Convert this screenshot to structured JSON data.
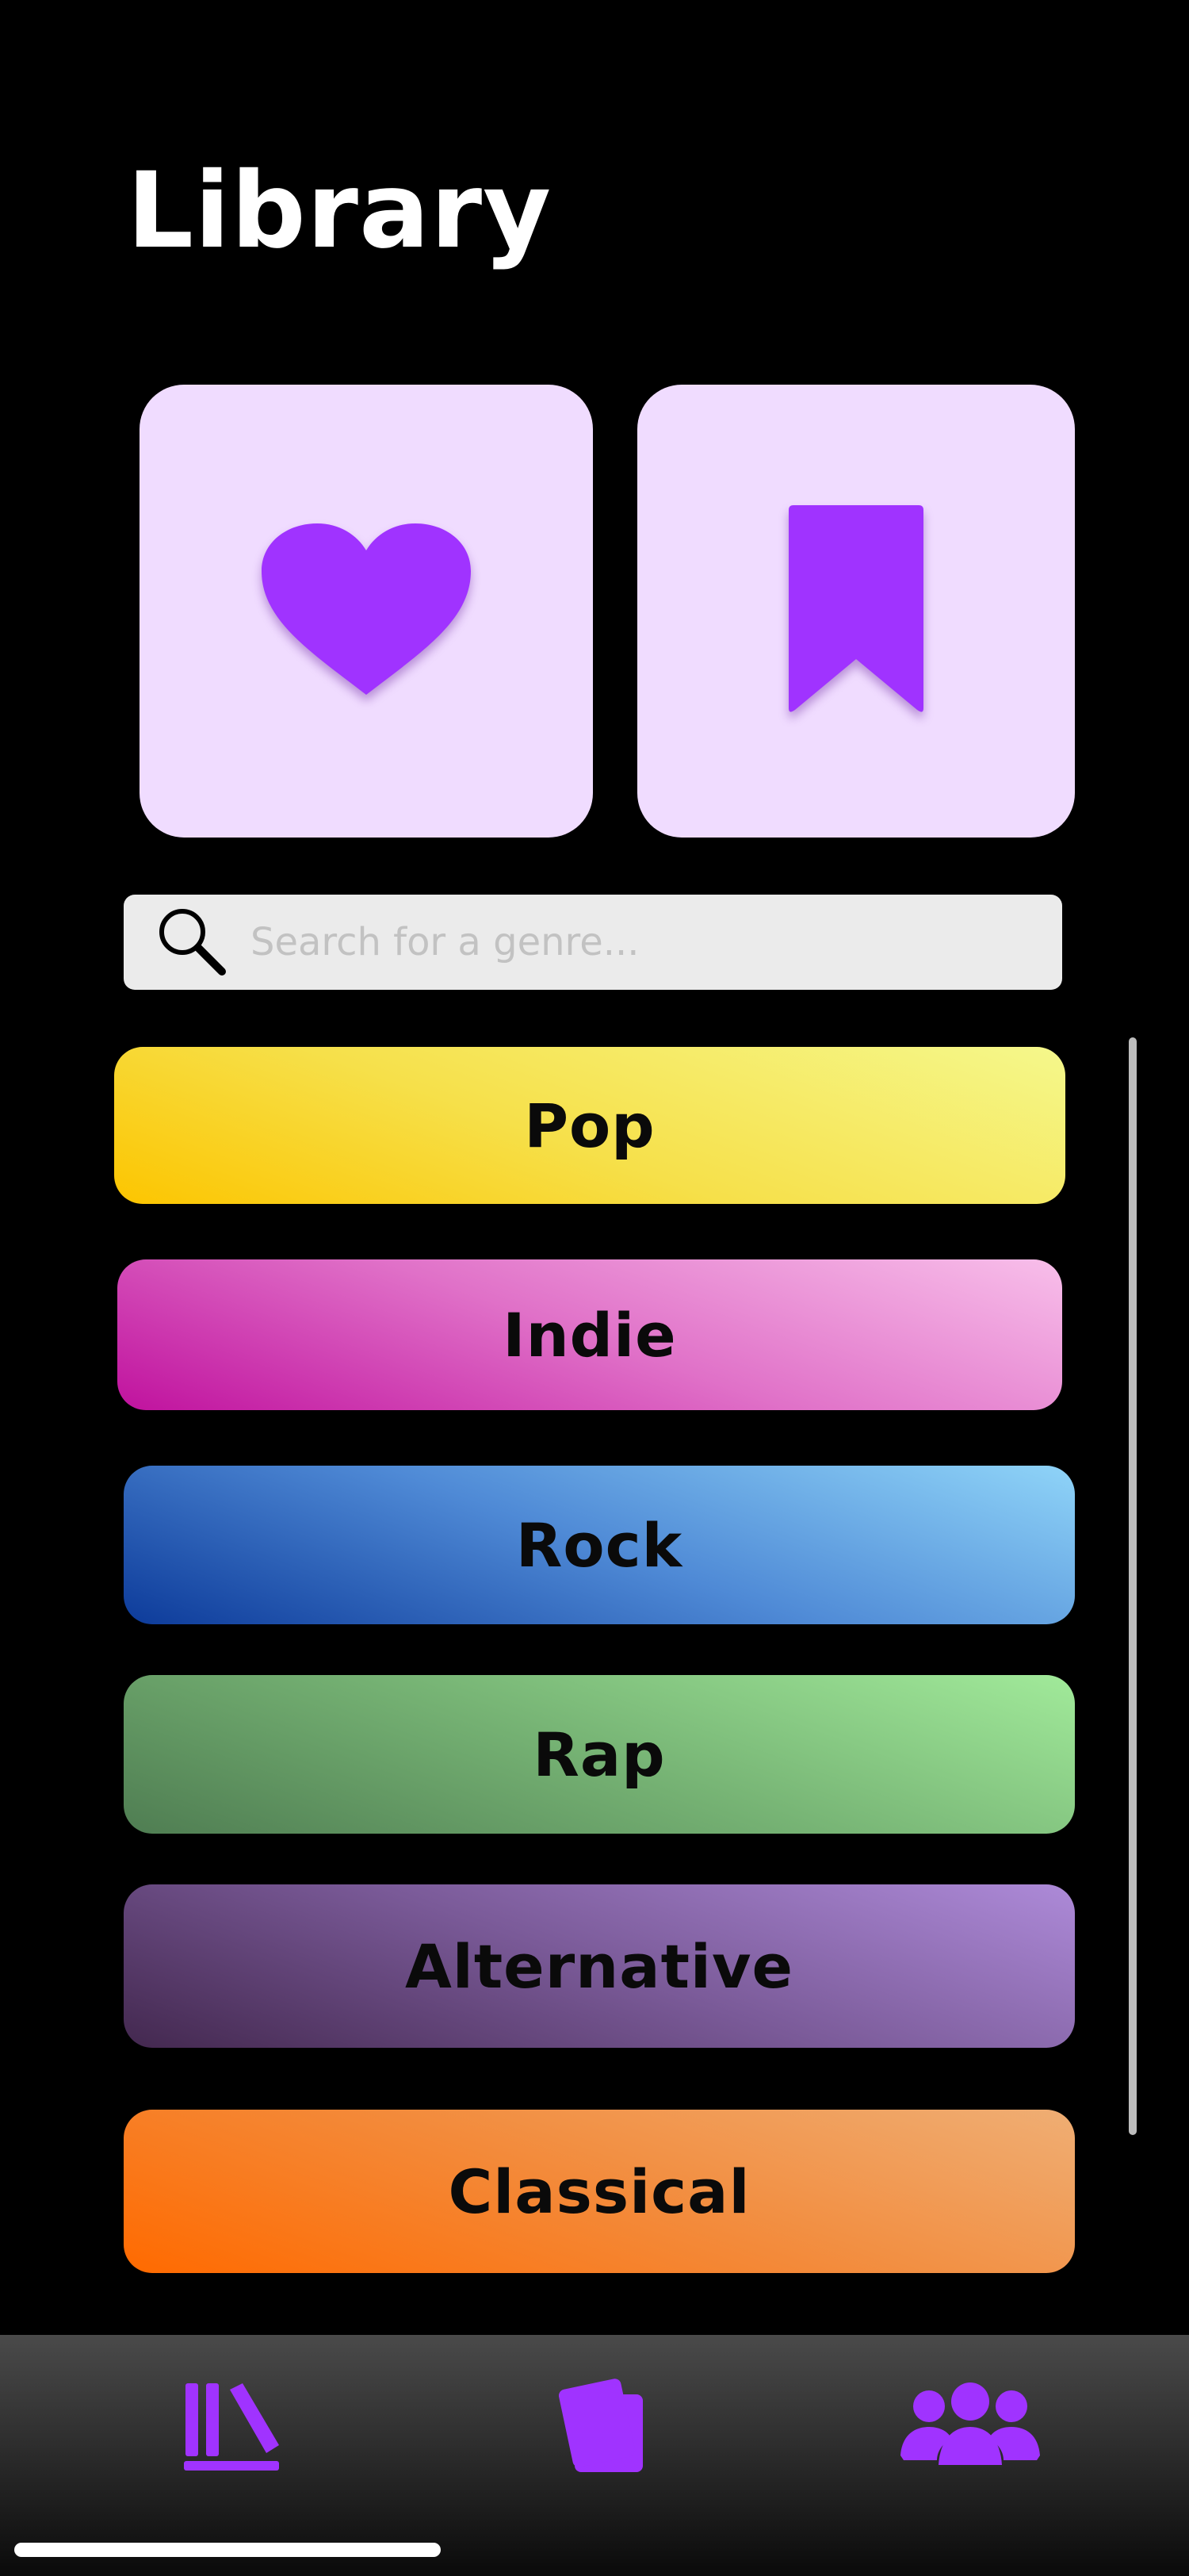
{
  "header": {
    "title": "Library"
  },
  "quick_access": [
    {
      "name": "liked",
      "icon": "heart-icon"
    },
    {
      "name": "saved",
      "icon": "bookmark-icon"
    }
  ],
  "search": {
    "placeholder": "Search for a genre...",
    "value": "",
    "icon": "search-icon"
  },
  "genres": [
    {
      "label": "Pop"
    },
    {
      "label": "Indie"
    },
    {
      "label": "Rock"
    },
    {
      "label": "Rap"
    },
    {
      "label": "Alternative"
    },
    {
      "label": "Classical"
    }
  ],
  "tab_bar": {
    "items": [
      {
        "name": "library",
        "icon": "library-icon"
      },
      {
        "name": "cards",
        "icon": "cards-icon"
      },
      {
        "name": "friends",
        "icon": "friends-icon"
      }
    ]
  },
  "colors": {
    "accent": "#a033ff",
    "card_background": "#f0dcff",
    "background": "#000000"
  }
}
